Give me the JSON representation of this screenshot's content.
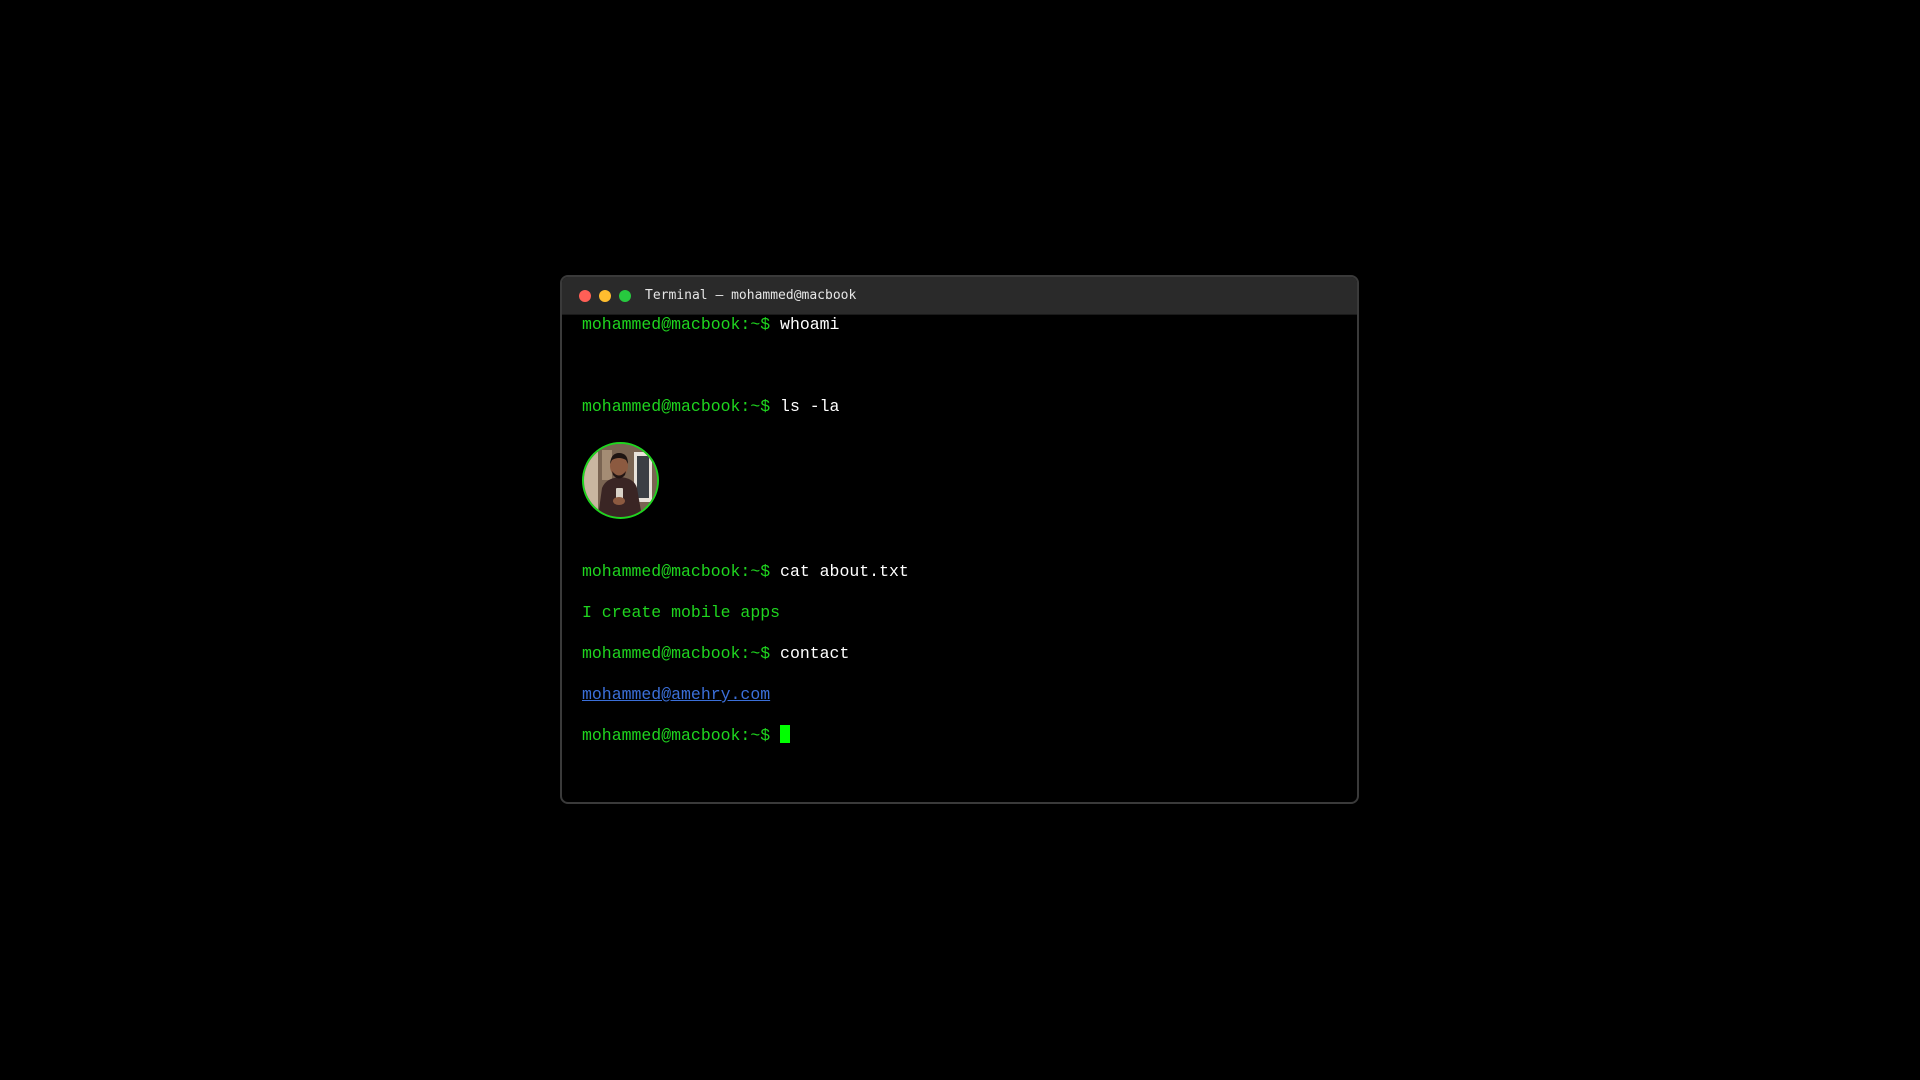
{
  "window": {
    "title": "Terminal — mohammed@macbook"
  },
  "terminal": {
    "prompt": "mohammed@macbook:~$",
    "entries": [
      {
        "command": "whoami"
      },
      {
        "command": "ls -la"
      },
      {
        "command": "cat about.txt",
        "output": "I create mobile apps"
      },
      {
        "command": "contact",
        "output": "mohammed@amehry.com"
      }
    ],
    "current_input": ""
  },
  "colors": {
    "prompt": "#1fd51f",
    "command": "#ffffff",
    "link": "#3b6fd9",
    "titlebar": "#2a2a2a",
    "cursor": "#00ff00"
  }
}
